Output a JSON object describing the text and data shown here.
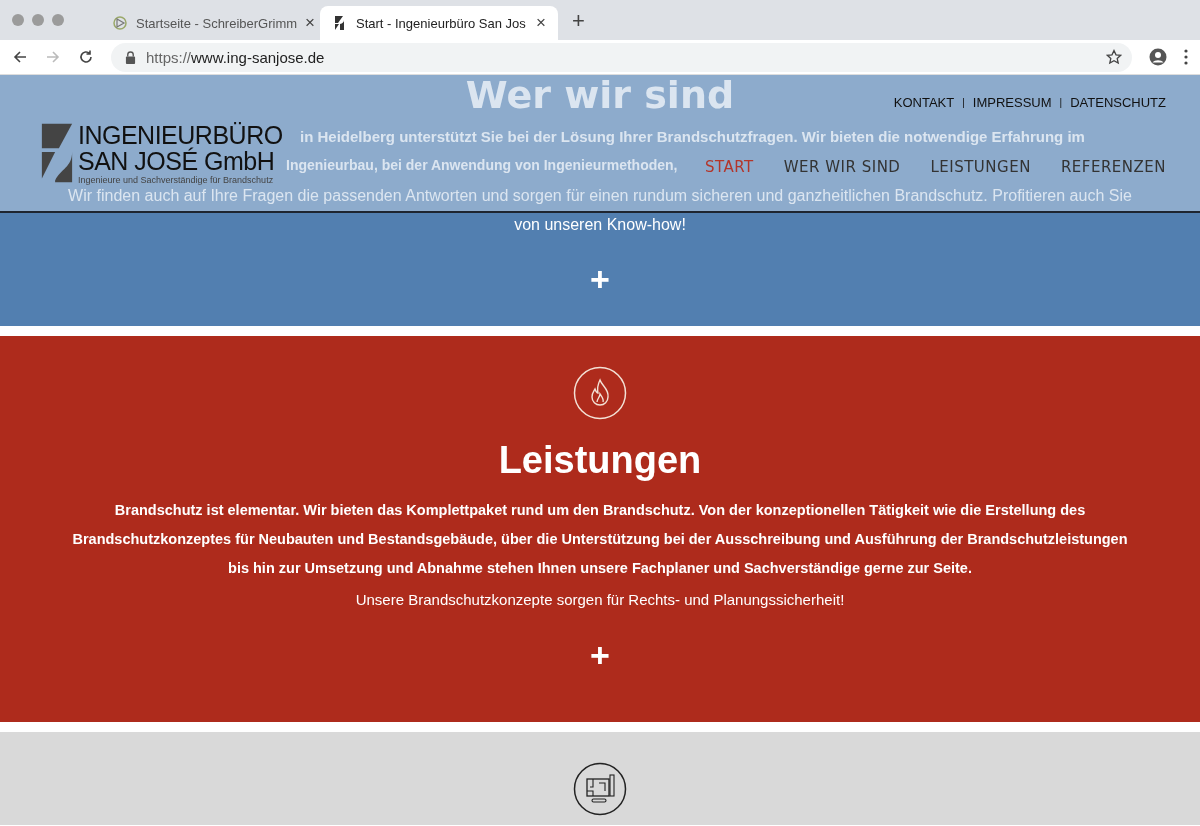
{
  "browser": {
    "tabs": [
      {
        "title": "Startseite - SchreiberGrimm",
        "selected": false
      },
      {
        "title": "Start - Ingenieurbüro San Jos",
        "selected": true
      }
    ],
    "new_tab": "+",
    "close": "×",
    "url_prefix": "https://",
    "url_host": "www.ing-sanjose.de"
  },
  "header": {
    "logo": {
      "line1": "INGENIEURBÜRO",
      "line2": "SAN JOSÉ GmbH",
      "tagline": "Ingenieure und Sachverständige für Brandschutz"
    },
    "top_links": [
      "KONTAKT",
      "IMPRESSUM",
      "DATENSCHUTZ"
    ],
    "separator": "|",
    "nav": [
      {
        "label": "START",
        "selected": true
      },
      {
        "label": "WER WIR SIND",
        "selected": false
      },
      {
        "label": "LEISTUNGEN",
        "selected": false
      },
      {
        "label": "REFERENZEN",
        "selected": false
      }
    ]
  },
  "sections": [
    {
      "kind": "about",
      "heading": "Wer wir sind",
      "lines": [
        "in Heidelberg unterstützt Sie bei der Lösung Ihrer Brandschutzfragen. Wir bieten die notwendige Erfahrung im",
        "Ingenieurbau, bei der Anwendung von Ingenieurmethoden,",
        "Wir finden auch auf Ihre Fragen die passenden Antworten und sorgen für einen rundum sicheren und ganzheitlichen Brandschutz. Profitieren auch Sie",
        "von unseren Know-how!"
      ],
      "expand": "+"
    },
    {
      "kind": "services",
      "heading": "Leistungen",
      "lead": "Brandschutz ist elementar. Wir bieten das Komplettpaket rund um den Brandschutz. Von der konzeptionellen Tätigkeit wie die Erstellung des Brandschutzkonzeptes für Neubauten und Bestandsgebäude, über die Unterstützung bei der Ausschreibung und Ausführung der Brandschutzleistungen bis hin zur Umsetzung und Abnahme stehen Ihnen unsere Fachplaner und Sachverständige gerne zur Seite.",
      "note": "Unsere Brandschutzkonzepte sorgen für Rechts- und Planungssicherheit!",
      "expand": "+"
    },
    {
      "kind": "references"
    }
  ]
}
